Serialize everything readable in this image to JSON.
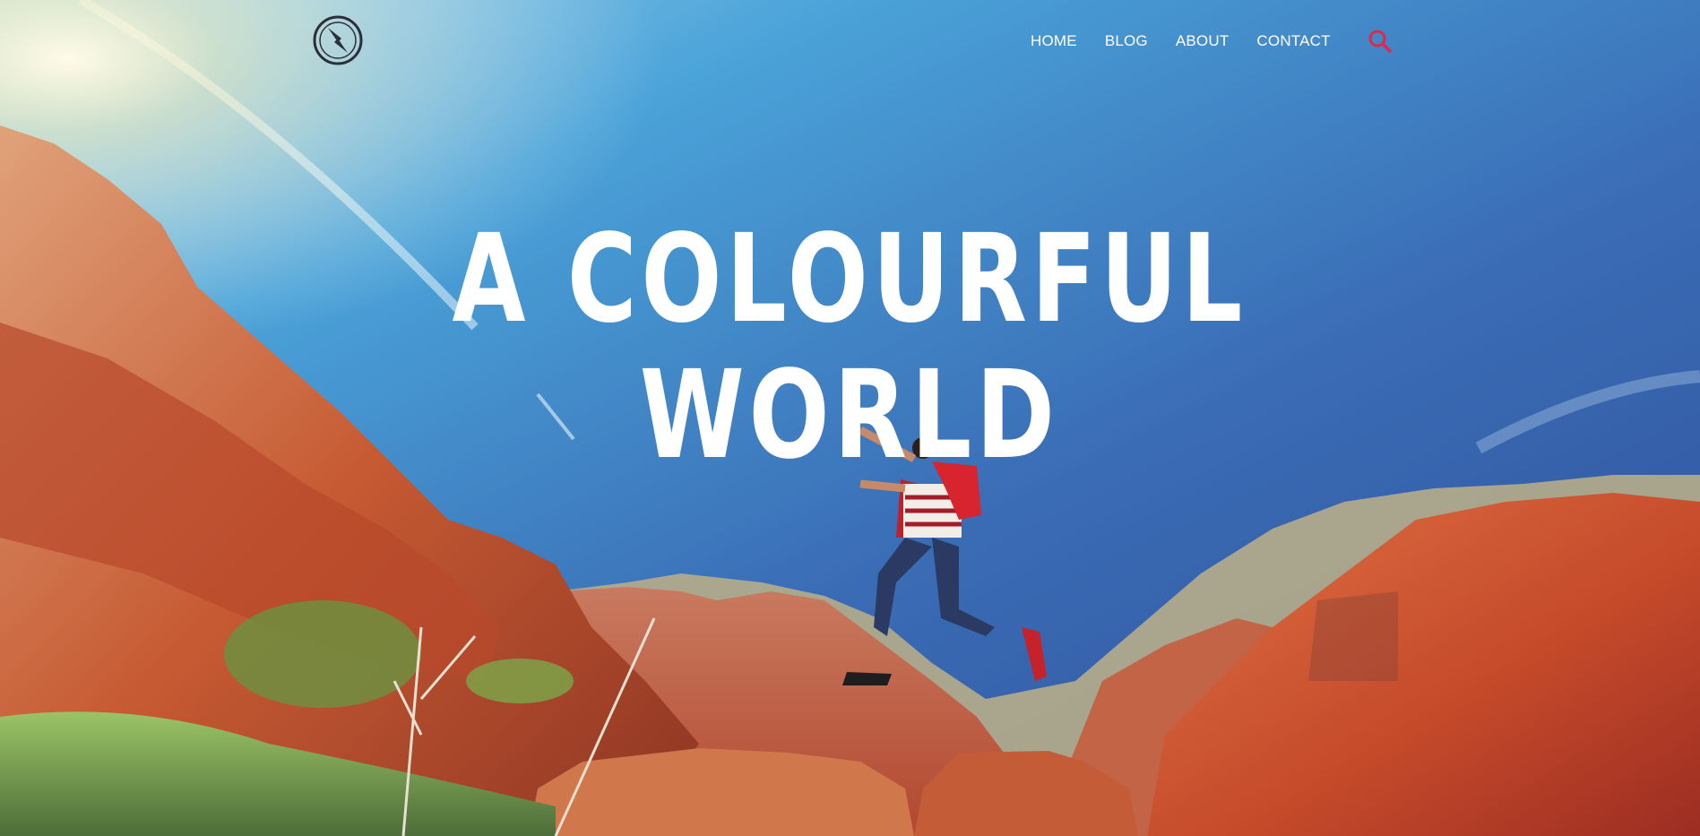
{
  "nav": {
    "items": [
      {
        "label": "HOME"
      },
      {
        "label": "BLOG"
      },
      {
        "label": "ABOUT"
      },
      {
        "label": "CONTACT"
      }
    ],
    "search_icon": "search-icon",
    "accent_color": "#e0284f"
  },
  "logo": {
    "icon": "compass-icon"
  },
  "hero": {
    "headline_line1": "A COLOURFUL",
    "headline_line2": "WORLD"
  },
  "colors": {
    "sky_top": "#3a5ea6",
    "sky_bottom": "#4fb1e6",
    "rock": "#c9542d",
    "text": "#ffffff"
  }
}
